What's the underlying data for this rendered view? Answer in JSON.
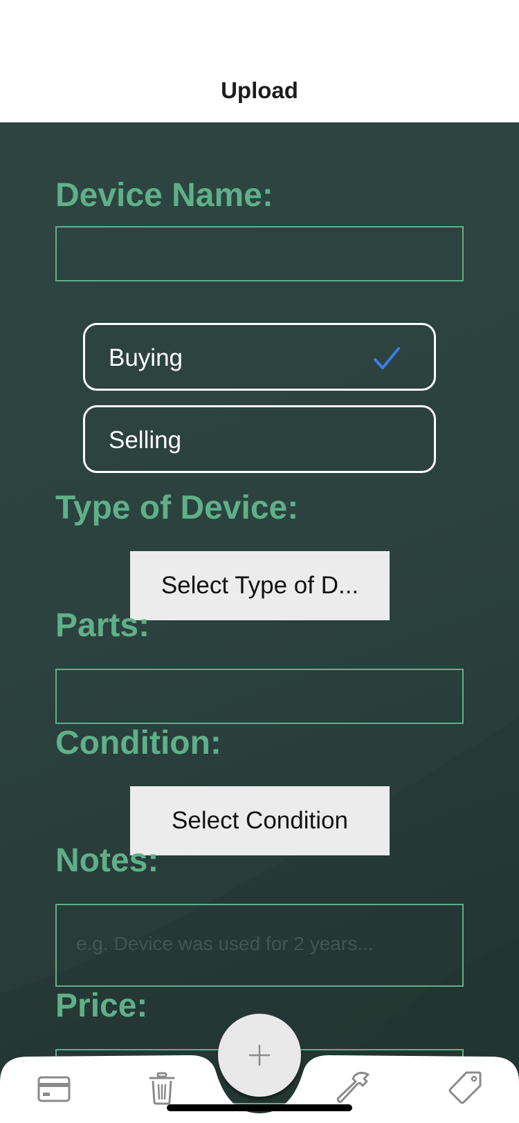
{
  "header": {
    "title": "Upload"
  },
  "form": {
    "device_name": {
      "label": "Device Name:",
      "value": "",
      "placeholder": ""
    },
    "mode_options": [
      {
        "label": "Buying",
        "selected": true
      },
      {
        "label": "Selling",
        "selected": false
      }
    ],
    "device_type": {
      "label": "Type of Device:",
      "button_label": "Select Type of D..."
    },
    "parts": {
      "label": "Parts:",
      "value": "",
      "placeholder": ""
    },
    "condition": {
      "label": "Condition:",
      "button_label": "Select Condition"
    },
    "notes": {
      "label": "Notes:",
      "value": "",
      "placeholder": "e.g. Device was used for 2 years..."
    },
    "price": {
      "label": "Price:",
      "value": ""
    }
  },
  "tab_bar": {
    "items": [
      {
        "icon": "credit-card-icon"
      },
      {
        "icon": "trash-icon"
      },
      {
        "icon": "plus-icon"
      },
      {
        "icon": "hammer-icon"
      },
      {
        "icon": "tag-icon"
      }
    ]
  },
  "colors": {
    "accent": "#5fb08a",
    "background": "#2c423e",
    "check": "#3a7ee8",
    "button": "#ececec"
  }
}
